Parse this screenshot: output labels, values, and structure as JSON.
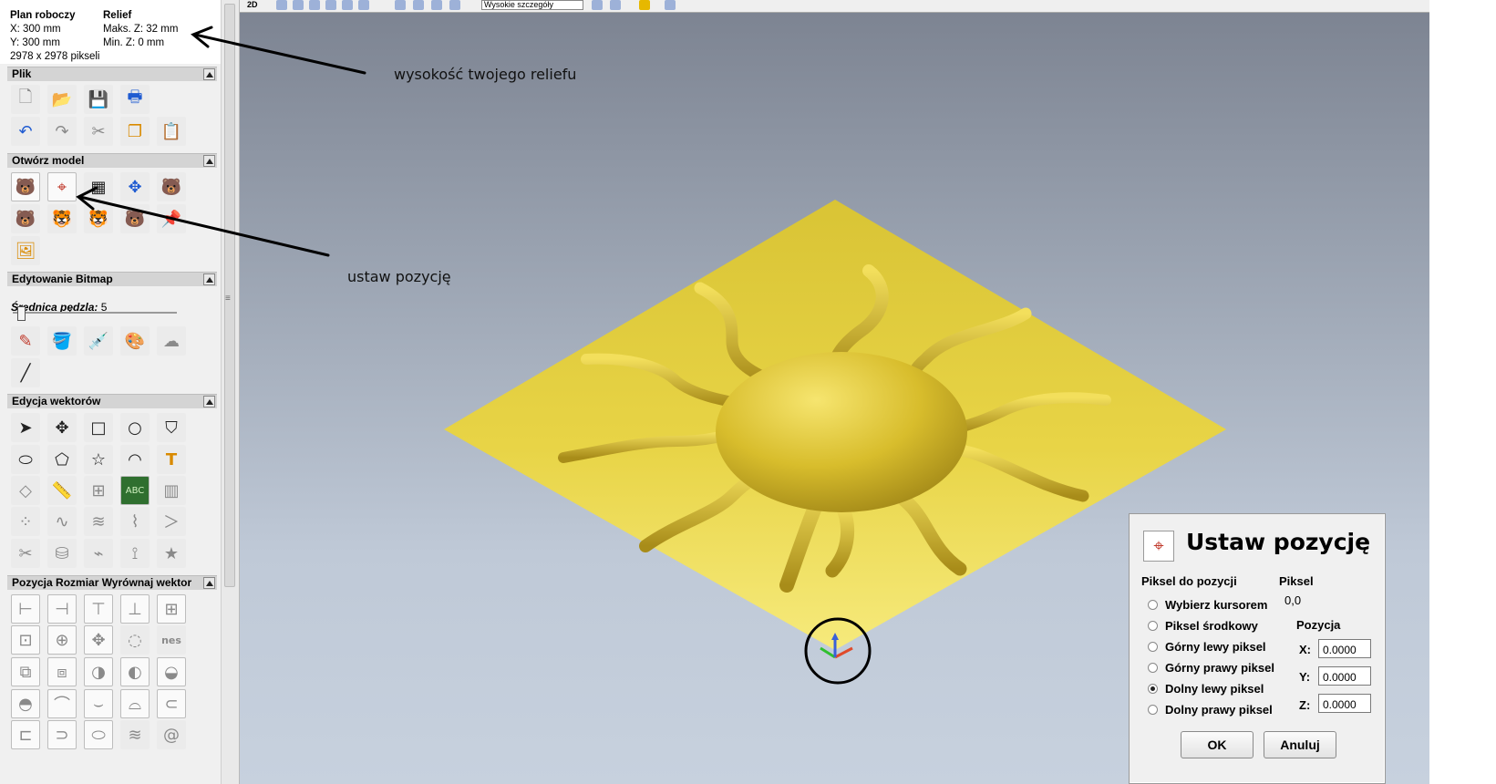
{
  "info": {
    "workplan_header": "Plan roboczy",
    "x": "X: 300 mm",
    "y": "Y: 300 mm",
    "pixels": "2978 x 2978 pikseli",
    "relief_header": "Relief",
    "max_z": "Maks. Z: 32 mm",
    "min_z": "Min. Z: 0 mm"
  },
  "sections": {
    "file": "Plik",
    "open_model": "Otwórz model",
    "bitmap_edit": "Edytowanie Bitmap",
    "vector_edit": "Edycja wektorów",
    "position_size": "Pozycja Rozmiar Wyrównaj wektor"
  },
  "brush": {
    "label": "Średnica pędzla:",
    "value": "5",
    "slider_fraction": 0.03
  },
  "toolbar": {
    "view_mode": "2D",
    "detail_select": "Wysokie szczegóły"
  },
  "annotations": {
    "relief_height": "wysokość twojego reliefu",
    "set_position": "ustaw pozycję"
  },
  "dialog": {
    "title": "Ustaw pozycję",
    "pixel_to_position": "Piksel do pozycji",
    "pixel_header": "Piksel",
    "pixel_value": "0,0",
    "position_header": "Pozycja",
    "options": [
      {
        "label": "Wybierz kursorem",
        "selected": false
      },
      {
        "label": "Piksel środkowy",
        "selected": false
      },
      {
        "label": "Górny lewy piksel",
        "selected": false
      },
      {
        "label": "Górny prawy piksel",
        "selected": false
      },
      {
        "label": "Dolny lewy piksel",
        "selected": true
      },
      {
        "label": "Dolny prawy piksel",
        "selected": false
      }
    ],
    "x_label": "X:",
    "y_label": "Y:",
    "z_label": "Z:",
    "x_value": "0.0000",
    "y_value": "0.0000",
    "z_value": "0.0000",
    "ok": "OK",
    "cancel": "Anuluj"
  },
  "colors": {
    "relief_base": "#e6cf3e",
    "relief_highlight": "#f4e374",
    "relief_shadow": "#b69a1c",
    "panel_bg": "#f0f0f0",
    "header_bg": "#d4d4d4"
  },
  "icons": {
    "file": [
      "new-file-icon",
      "open-folder-icon",
      "save-icon",
      "export-icon",
      "undo-icon",
      "redo-icon",
      "cut-icon",
      "copy-icon",
      "paste-icon"
    ],
    "open_model": [
      "open-model-icon",
      "set-position-icon",
      "checker-icon",
      "center-icon",
      "bear-model-icon",
      "bear-scale-icon",
      "tiger-model-icon",
      "tiger-rotate-icon",
      "grey-model-icon",
      "pin-icon",
      "mona-lisa-icon"
    ],
    "bitmap": [
      "pencil-icon",
      "fill-icon",
      "dropper-icon",
      "palette-icon",
      "cloud-icon",
      "line-icon"
    ],
    "vector": [
      "select-arrow-icon",
      "transform-icon",
      "rectangle-icon",
      "circle-icon",
      "polyline-icon",
      "ellipse-icon",
      "polygon-icon",
      "star-icon",
      "arc-icon",
      "text-icon",
      "offset-icon",
      "measure-icon",
      "grid-icon",
      "abc-icon",
      "mesh-icon",
      "nodes-icon",
      "curve-icon",
      "wave-icon",
      "bezier-icon",
      "arrow-line-icon",
      "scissors-icon",
      "cylinder-icon",
      "tweak-icon",
      "divide-icon",
      "star-shape-icon"
    ],
    "position": [
      "align-left-icon",
      "align-center-h-icon",
      "align-top-icon",
      "align-bottom-icon",
      "distribute-h-icon",
      "align-right-icon",
      "center-page-icon",
      "center-move-icon",
      "circle-dots-icon",
      "nesting-icon",
      "group-icon",
      "ungroup-icon",
      "weld-icon",
      "merge-icon",
      "subtract-icon",
      "intersect-icon",
      "join-icon",
      "fillet-icon",
      "chamfer-icon",
      "close-icon",
      "trim-icon",
      "extend-icon",
      "outline-icon",
      "texture-icon",
      "spiral-icon"
    ]
  }
}
